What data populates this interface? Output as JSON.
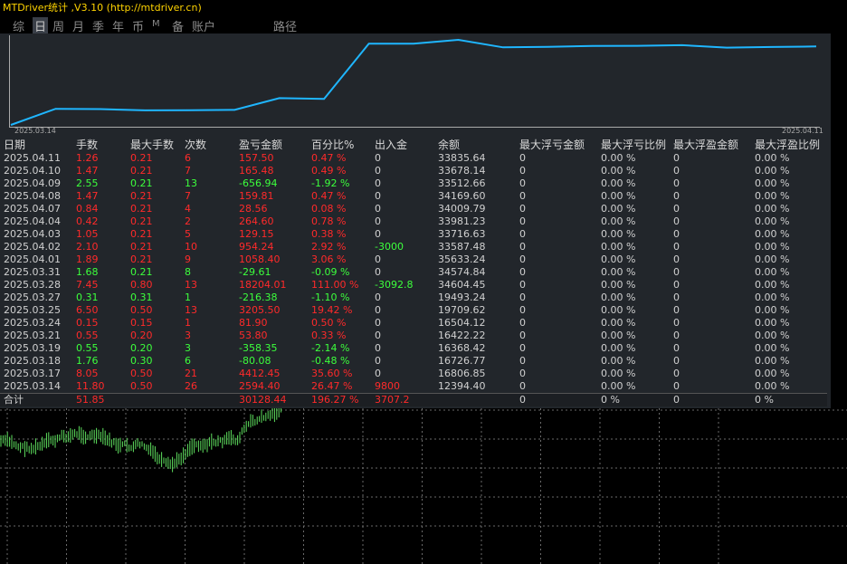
{
  "app": {
    "title": "MTDriver统计 ,V3.10 (http://mtdriver.cn)"
  },
  "tabs": [
    {
      "label": "综",
      "active": false
    },
    {
      "label": "日",
      "active": true
    },
    {
      "label": "周",
      "active": false
    },
    {
      "label": "月",
      "active": false
    },
    {
      "label": "季",
      "active": false
    },
    {
      "label": "年",
      "active": false
    },
    {
      "label": "币",
      "active": false
    },
    {
      "label": "M",
      "active": false
    },
    {
      "label": "备",
      "active": false
    },
    {
      "label": "账户",
      "active": false
    },
    {
      "label": "路径",
      "active": false
    }
  ],
  "equity": {
    "start_label": "2025.03.14",
    "end_label": "2025.04.11",
    "line_color": "#1fb6ff",
    "points": [
      12394.4,
      16806.85,
      16726.77,
      16368.42,
      16422.22,
      16504.12,
      19709.62,
      19493.24,
      34604.45,
      34574.84,
      35633.24,
      33587.48,
      33716.63,
      33981.23,
      34009.79,
      34169.6,
      33512.66,
      33678.14,
      33835.64
    ]
  },
  "table": {
    "headers": [
      "日期",
      "手数",
      "最大手数",
      "次数",
      "盈亏金额",
      "百分比%",
      "出入金",
      "余额",
      "最大浮亏金额",
      "最大浮亏比例",
      "最大浮盈金额",
      "最大浮盈比例"
    ],
    "rows": [
      {
        "date": "2025.04.11",
        "lots": "1.26",
        "max": "0.21",
        "count": "6",
        "pnl": "157.50",
        "pct": "0.47 %",
        "io": "0",
        "bal": "33835.64",
        "c": "red",
        "ioc": "grey"
      },
      {
        "date": "2025.04.10",
        "lots": "1.47",
        "max": "0.21",
        "count": "7",
        "pnl": "165.48",
        "pct": "0.49 %",
        "io": "0",
        "bal": "33678.14",
        "c": "red",
        "ioc": "grey"
      },
      {
        "date": "2025.04.09",
        "lots": "2.55",
        "max": "0.21",
        "count": "13",
        "pnl": "-656.94",
        "pct": "-1.92 %",
        "io": "0",
        "bal": "33512.66",
        "c": "green",
        "ioc": "grey"
      },
      {
        "date": "2025.04.08",
        "lots": "1.47",
        "max": "0.21",
        "count": "7",
        "pnl": "159.81",
        "pct": "0.47 %",
        "io": "0",
        "bal": "34169.60",
        "c": "red",
        "ioc": "grey"
      },
      {
        "date": "2025.04.07",
        "lots": "0.84",
        "max": "0.21",
        "count": "4",
        "pnl": "28.56",
        "pct": "0.08 %",
        "io": "0",
        "bal": "34009.79",
        "c": "red",
        "ioc": "grey"
      },
      {
        "date": "2025.04.04",
        "lots": "0.42",
        "max": "0.21",
        "count": "2",
        "pnl": "264.60",
        "pct": "0.78 %",
        "io": "0",
        "bal": "33981.23",
        "c": "red",
        "ioc": "grey"
      },
      {
        "date": "2025.04.03",
        "lots": "1.05",
        "max": "0.21",
        "count": "5",
        "pnl": "129.15",
        "pct": "0.38 %",
        "io": "0",
        "bal": "33716.63",
        "c": "red",
        "ioc": "grey"
      },
      {
        "date": "2025.04.02",
        "lots": "2.10",
        "max": "0.21",
        "count": "10",
        "pnl": "954.24",
        "pct": "2.92 %",
        "io": "-3000",
        "bal": "33587.48",
        "c": "red",
        "ioc": "green"
      },
      {
        "date": "2025.04.01",
        "lots": "1.89",
        "max": "0.21",
        "count": "9",
        "pnl": "1058.40",
        "pct": "3.06 %",
        "io": "0",
        "bal": "35633.24",
        "c": "red",
        "ioc": "grey"
      },
      {
        "date": "2025.03.31",
        "lots": "1.68",
        "max": "0.21",
        "count": "8",
        "pnl": "-29.61",
        "pct": "-0.09 %",
        "io": "0",
        "bal": "34574.84",
        "c": "green",
        "ioc": "grey"
      },
      {
        "date": "2025.03.28",
        "lots": "7.45",
        "max": "0.80",
        "count": "13",
        "pnl": "18204.01",
        "pct": "111.00 %",
        "io": "-3092.8",
        "bal": "34604.45",
        "c": "red",
        "ioc": "green"
      },
      {
        "date": "2025.03.27",
        "lots": "0.31",
        "max": "0.31",
        "count": "1",
        "pnl": "-216.38",
        "pct": "-1.10 %",
        "io": "0",
        "bal": "19493.24",
        "c": "green",
        "ioc": "grey"
      },
      {
        "date": "2025.03.25",
        "lots": "6.50",
        "max": "0.50",
        "count": "13",
        "pnl": "3205.50",
        "pct": "19.42 %",
        "io": "0",
        "bal": "19709.62",
        "c": "red",
        "ioc": "grey"
      },
      {
        "date": "2025.03.24",
        "lots": "0.15",
        "max": "0.15",
        "count": "1",
        "pnl": "81.90",
        "pct": "0.50 %",
        "io": "0",
        "bal": "16504.12",
        "c": "red",
        "ioc": "grey"
      },
      {
        "date": "2025.03.21",
        "lots": "0.55",
        "max": "0.20",
        "count": "3",
        "pnl": "53.80",
        "pct": "0.33 %",
        "io": "0",
        "bal": "16422.22",
        "c": "red",
        "ioc": "grey"
      },
      {
        "date": "2025.03.19",
        "lots": "0.55",
        "max": "0.20",
        "count": "3",
        "pnl": "-358.35",
        "pct": "-2.14 %",
        "io": "0",
        "bal": "16368.42",
        "c": "green",
        "ioc": "grey"
      },
      {
        "date": "2025.03.18",
        "lots": "1.76",
        "max": "0.30",
        "count": "6",
        "pnl": "-80.08",
        "pct": "-0.48 %",
        "io": "0",
        "bal": "16726.77",
        "c": "green",
        "ioc": "grey"
      },
      {
        "date": "2025.03.17",
        "lots": "8.05",
        "max": "0.50",
        "count": "21",
        "pnl": "4412.45",
        "pct": "35.60 %",
        "io": "0",
        "bal": "16806.85",
        "c": "red",
        "ioc": "grey"
      },
      {
        "date": "2025.03.14",
        "lots": "11.80",
        "max": "0.50",
        "count": "26",
        "pnl": "2594.40",
        "pct": "26.47 %",
        "io": "9800",
        "bal": "12394.40",
        "c": "red",
        "ioc": "red"
      }
    ],
    "zero": "0",
    "zero_pct": "0.00 %",
    "total": {
      "label": "合计",
      "lots": "51.85",
      "pnl": "30128.44",
      "pct": "196.27 %",
      "io": "3707.2",
      "f1": "0",
      "f2": "0 %",
      "f3": "0",
      "f4": "0 %"
    }
  }
}
